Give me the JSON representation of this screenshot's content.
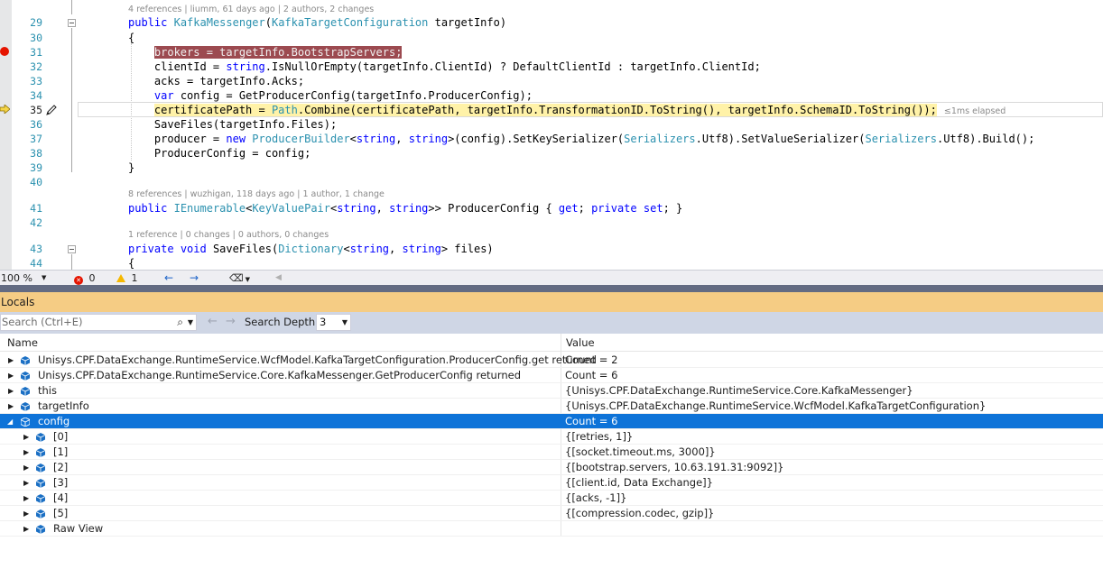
{
  "editor": {
    "line_numbers": [
      "29",
      "30",
      "31",
      "32",
      "33",
      "34",
      "35",
      "36",
      "37",
      "38",
      "39",
      "40",
      "41",
      "42",
      "43",
      "44"
    ],
    "codelens": [
      "4 references | liumm, 61 days ago | 2 authors, 2 changes",
      "8 references | wuzhigan, 118 days ago | 1 author, 1 change",
      "1 reference | 0 changes | 0 authors, 0 changes"
    ],
    "elapsed": "≤1ms elapsed"
  },
  "status": {
    "zoom": "100 %",
    "errors": "0",
    "warnings": "1"
  },
  "locals": {
    "title": "Locals",
    "search_placeholder": "Search (Ctrl+E)",
    "search_depth_label": "Search Depth:",
    "search_depth_value": "3",
    "columns": {
      "name": "Name",
      "value": "Value"
    },
    "rows": [
      {
        "name": "Unisys.CPF.DataExchange.RuntimeService.WcfModel.KafkaTargetConfiguration.ProducerConfig.get returned",
        "value": "Count = 2"
      },
      {
        "name": "Unisys.CPF.DataExchange.RuntimeService.Core.KafkaMessenger.GetProducerConfig returned",
        "value": "Count = 6"
      },
      {
        "name": "this",
        "value": "{Unisys.CPF.DataExchange.RuntimeService.Core.KafkaMessenger}"
      },
      {
        "name": "targetInfo",
        "value": "{Unisys.CPF.DataExchange.RuntimeService.WcfModel.KafkaTargetConfiguration}"
      },
      {
        "name": "config",
        "value": "Count = 6"
      },
      {
        "name": "[0]",
        "value": "{[retries, 1]}"
      },
      {
        "name": "[1]",
        "value": "{[socket.timeout.ms, 3000]}"
      },
      {
        "name": "[2]",
        "value": "{[bootstrap.servers, 10.63.191.31:9092]}"
      },
      {
        "name": "[3]",
        "value": "{[client.id, Data Exchange]}"
      },
      {
        "name": "[4]",
        "value": "{[acks, -1]}"
      },
      {
        "name": "[5]",
        "value": "{[compression.codec, gzip]}"
      },
      {
        "name": "Raw View",
        "value": ""
      }
    ]
  }
}
